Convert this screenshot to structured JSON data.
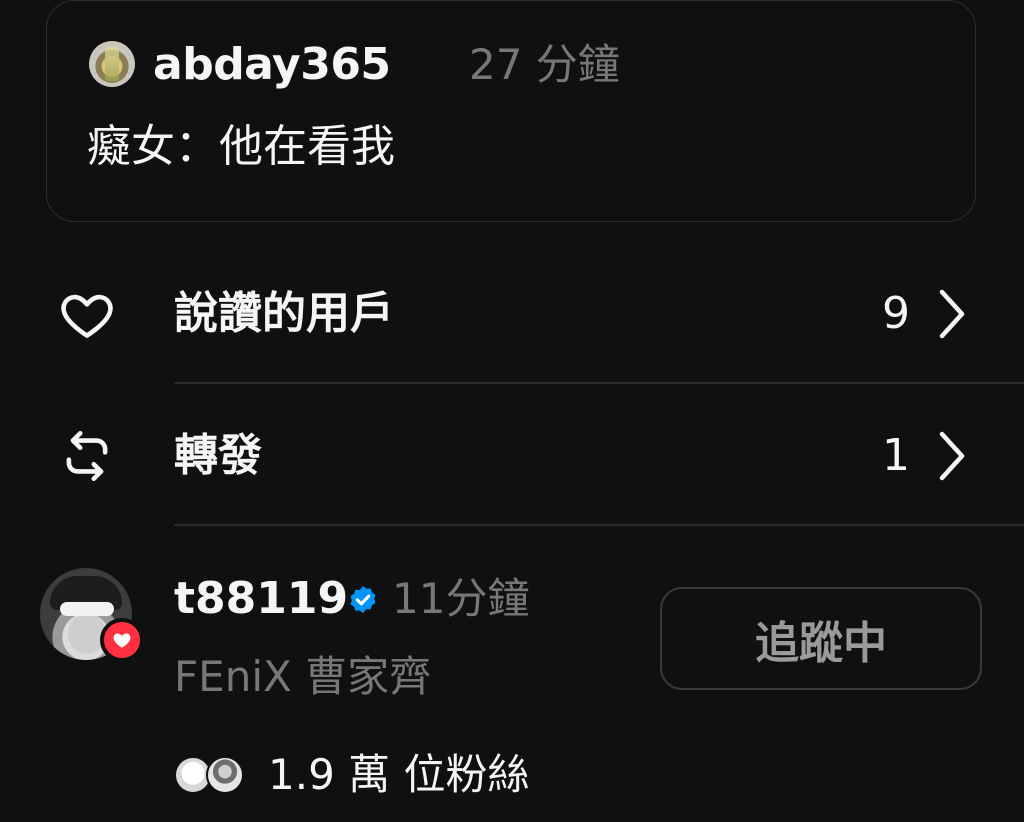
{
  "quoted_post": {
    "username": "abday365",
    "time": "27 分鐘",
    "text": "癡女：他在看我"
  },
  "stats": [
    {
      "icon": "heart-icon",
      "label": "說讚的用戶",
      "count": "9"
    },
    {
      "icon": "repost-icon",
      "label": "轉發",
      "count": "1"
    }
  ],
  "user": {
    "username": "t88119",
    "time": "11分鐘",
    "bio": "FEniX 曹家齊",
    "follow_label": "追蹤中",
    "followers": "1.9 萬 位粉絲"
  },
  "colors": {
    "background": "#101010",
    "muted_text": "#777777",
    "like_badge": "#ff3040",
    "verified": "#0095f6"
  }
}
